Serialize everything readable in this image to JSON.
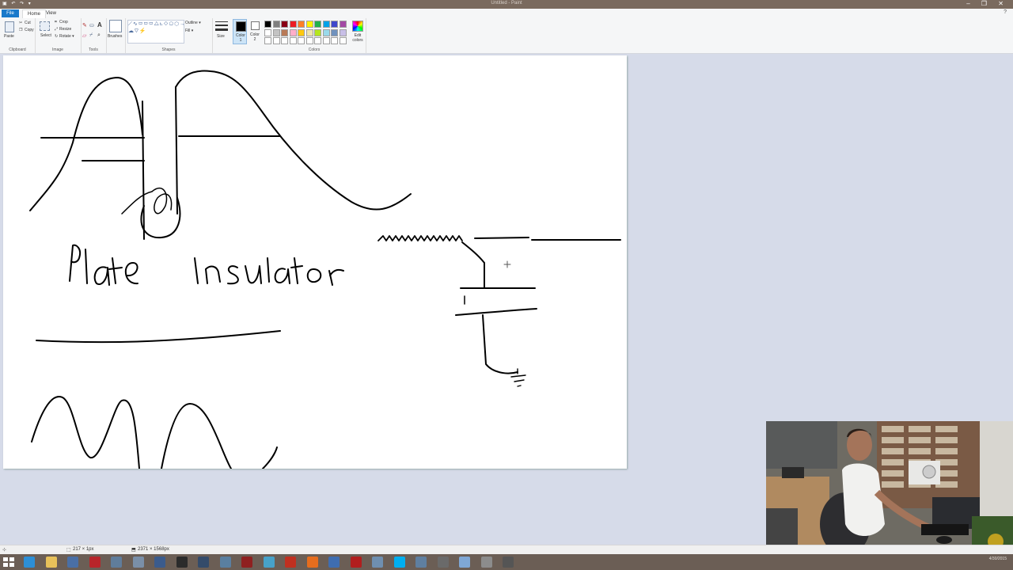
{
  "window": {
    "title": "Untitled - Paint",
    "quick_access": "▣ ↶ ↷ ▾",
    "window_controls": "–  ❐  ✕"
  },
  "tabs": {
    "file": "File",
    "home": "Home",
    "view": "View",
    "help_icon": "?"
  },
  "ribbon": {
    "clipboard": {
      "paste": "Paste",
      "cut": "Cut",
      "copy": "Copy",
      "label": "Clipboard"
    },
    "image": {
      "select": "Select",
      "crop": "Crop",
      "resize": "Resize",
      "rotate": "Rotate ▾",
      "label": "Image"
    },
    "tools": {
      "label": "Tools"
    },
    "brushes": {
      "label": "Brushes"
    },
    "shapes": {
      "outline": "Outline ▾",
      "fill": "Fill ▾",
      "label": "Shapes"
    },
    "size": {
      "label": "Size"
    },
    "color1": {
      "label": "Color 1"
    },
    "color2": {
      "label": "Color 2"
    },
    "colors": {
      "label": "Colors",
      "edit": "Edit colors",
      "row1": [
        "#000000",
        "#7f7f7f",
        "#880015",
        "#ed1c24",
        "#ff7f27",
        "#fff200",
        "#22b14c",
        "#00a2e8",
        "#3f48cc",
        "#a349a4"
      ],
      "row2": [
        "#ffffff",
        "#c3c3c3",
        "#b97a57",
        "#ffaec9",
        "#ffc90e",
        "#efe4b0",
        "#b5e61d",
        "#99d9ea",
        "#7092be",
        "#c8bfe7"
      ],
      "row3": [
        "#ffffff",
        "#ffffff",
        "#ffffff",
        "#ffffff",
        "#ffffff",
        "#ffffff",
        "#ffffff",
        "#ffffff",
        "#ffffff",
        "#ffffff"
      ]
    }
  },
  "status": {
    "cursor_pos": "217 × 1px",
    "image_size": "2371 × 1568px"
  },
  "taskbar": {
    "clock": "4/30/2015",
    "icons": [
      {
        "name": "ie",
        "color": "#2d8fd6"
      },
      {
        "name": "explorer",
        "color": "#e8c15a"
      },
      {
        "name": "app",
        "color": "#4a6fa5"
      },
      {
        "name": "filezilla",
        "color": "#b8252a"
      },
      {
        "name": "app2",
        "color": "#607d9b"
      },
      {
        "name": "app3",
        "color": "#7a8fa8"
      },
      {
        "name": "app4",
        "color": "#3b5b8c"
      },
      {
        "name": "obs",
        "color": "#2b2b2b"
      },
      {
        "name": "app5",
        "color": "#344b6a"
      },
      {
        "name": "app6",
        "color": "#5a7fa0"
      },
      {
        "name": "app7",
        "color": "#8f2020"
      },
      {
        "name": "app8",
        "color": "#47a2c9"
      },
      {
        "name": "app9",
        "color": "#c03020"
      },
      {
        "name": "firefox",
        "color": "#e66d1e"
      },
      {
        "name": "app10",
        "color": "#3f6db0"
      },
      {
        "name": "acrobat",
        "color": "#b11e1e"
      },
      {
        "name": "app11",
        "color": "#6f8fb0"
      },
      {
        "name": "skype",
        "color": "#00aff0"
      },
      {
        "name": "app12",
        "color": "#5f7fa0"
      },
      {
        "name": "app13",
        "color": "#6a6a6a"
      },
      {
        "name": "paint",
        "color": "#7fa7d5"
      },
      {
        "name": "app14",
        "color": "#8c8c8c"
      },
      {
        "name": "app15",
        "color": "#555555"
      }
    ]
  }
}
